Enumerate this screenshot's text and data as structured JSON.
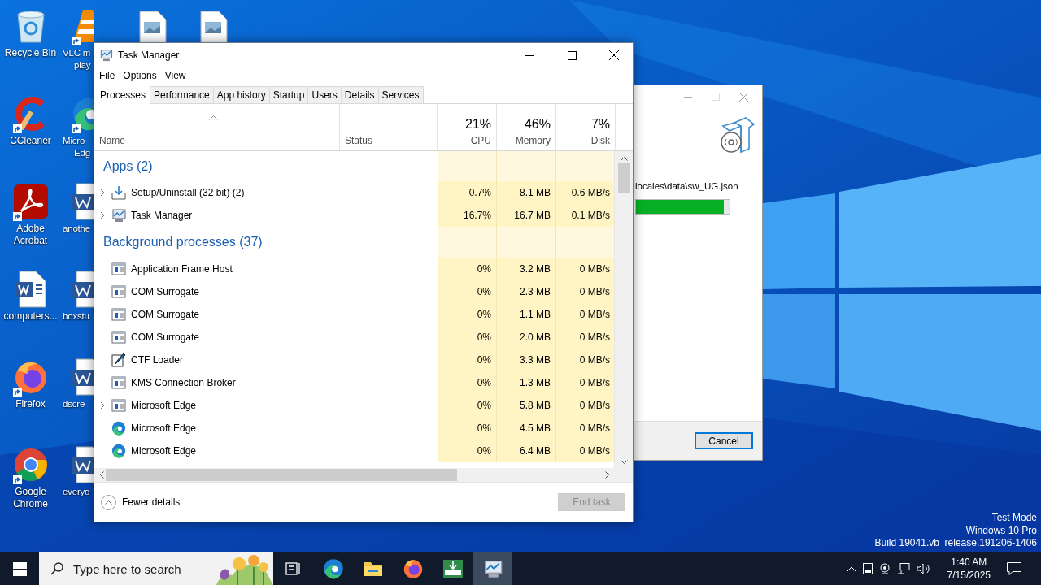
{
  "desktop_columns": [
    [
      {
        "label": [
          "Recycle Bin"
        ],
        "kind": "recycle",
        "shortcut": false
      },
      {
        "label": [
          "CCleaner"
        ],
        "kind": "ccleaner",
        "shortcut": true
      },
      {
        "label": [
          "Adobe",
          "Acrobat"
        ],
        "kind": "acrobat",
        "shortcut": true
      },
      {
        "label": [
          "computers..."
        ],
        "kind": "word-doc",
        "shortcut": false
      },
      {
        "label": [
          "Firefox"
        ],
        "kind": "firefox",
        "shortcut": true
      },
      {
        "label": [
          "Google",
          "Chrome"
        ],
        "kind": "chrome",
        "shortcut": true
      }
    ],
    [
      {
        "label": [
          "VLC m",
          "play"
        ],
        "kind": "vlc",
        "shortcut": true
      },
      {
        "label": [
          "Micro",
          "Edg"
        ],
        "kind": "edge",
        "shortcut": true
      },
      {
        "label": [
          "anothe"
        ],
        "kind": "word",
        "shortcut": false
      },
      {
        "label": [
          "boxstu"
        ],
        "kind": "word",
        "shortcut": false
      },
      {
        "label": [
          "dscre"
        ],
        "kind": "word",
        "shortcut": false
      },
      {
        "label": [
          "everyo"
        ],
        "kind": "word",
        "shortcut": false
      }
    ]
  ],
  "task_manager": {
    "title": "Task Manager",
    "menu": [
      "File",
      "Options",
      "View"
    ],
    "tabs": [
      {
        "label": "Processes",
        "selected": true
      },
      {
        "label": "Performance",
        "selected": false
      },
      {
        "label": "App history",
        "selected": false
      },
      {
        "label": "Startup",
        "selected": false
      },
      {
        "label": "Users",
        "selected": false
      },
      {
        "label": "Details",
        "selected": false
      },
      {
        "label": "Services",
        "selected": false
      }
    ],
    "columns": [
      {
        "name": "Name"
      },
      {
        "name": "Status"
      },
      {
        "name": "CPU",
        "total": "21%"
      },
      {
        "name": "Memory",
        "total": "46%"
      },
      {
        "name": "Disk",
        "total": "7%"
      }
    ],
    "groups": [
      {
        "title": "Apps (2)",
        "rows": [
          {
            "name": "Setup/Uninstall (32 bit) (2)",
            "kind": "installer",
            "expandable": true,
            "cpu": "0.7%",
            "memory": "8.1 MB",
            "disk": "0.6 MB/s"
          },
          {
            "name": "Task Manager",
            "kind": "taskmgr",
            "expandable": true,
            "cpu": "16.7%",
            "memory": "16.7 MB",
            "disk": "0.1 MB/s"
          }
        ]
      },
      {
        "title": "Background processes (37)",
        "rows": [
          {
            "name": "Application Frame Host",
            "kind": "window",
            "expandable": false,
            "cpu": "0%",
            "memory": "3.2 MB",
            "disk": "0 MB/s"
          },
          {
            "name": "COM Surrogate",
            "kind": "window",
            "expandable": false,
            "cpu": "0%",
            "memory": "2.3 MB",
            "disk": "0 MB/s"
          },
          {
            "name": "COM Surrogate",
            "kind": "window",
            "expandable": false,
            "cpu": "0%",
            "memory": "1.1 MB",
            "disk": "0 MB/s"
          },
          {
            "name": "COM Surrogate",
            "kind": "window",
            "expandable": false,
            "cpu": "0%",
            "memory": "2.0 MB",
            "disk": "0 MB/s"
          },
          {
            "name": "CTF Loader",
            "kind": "pen",
            "expandable": false,
            "cpu": "0%",
            "memory": "3.3 MB",
            "disk": "0 MB/s"
          },
          {
            "name": "KMS Connection Broker",
            "kind": "window",
            "expandable": false,
            "cpu": "0%",
            "memory": "1.3 MB",
            "disk": "0 MB/s"
          },
          {
            "name": "Microsoft Edge",
            "kind": "window",
            "expandable": true,
            "cpu": "0%",
            "memory": "5.8 MB",
            "disk": "0 MB/s"
          },
          {
            "name": "Microsoft Edge",
            "kind": "edge",
            "expandable": false,
            "cpu": "0%",
            "memory": "4.5 MB",
            "disk": "0 MB/s"
          },
          {
            "name": "Microsoft Edge",
            "kind": "edge",
            "expandable": false,
            "cpu": "0%",
            "memory": "6.4 MB",
            "disk": "0 MB/s"
          }
        ]
      }
    ],
    "fewer_details": "Fewer details",
    "end_task": {
      "label": "End task",
      "disabled": true
    }
  },
  "installer": {
    "path_text": "locales\\data\\sw_UG.json",
    "progress": {
      "level": 0.94
    },
    "cancel": "Cancel"
  },
  "taskbar": {
    "search_placeholder": "Type here to search",
    "apps": [
      {
        "kind": "task-view",
        "active": false
      },
      {
        "kind": "edge",
        "active": false
      },
      {
        "kind": "folder",
        "active": false
      },
      {
        "kind": "firefox",
        "active": false
      },
      {
        "kind": "installer",
        "active": false
      },
      {
        "kind": "taskmgr",
        "active": true
      }
    ],
    "clock": {
      "time": "1:40 AM",
      "date": "7/15/2025"
    }
  },
  "system_text": [
    "Test Mode",
    "Windows 10 Pro",
    "Build 19041.vb_release.191206-1406"
  ]
}
